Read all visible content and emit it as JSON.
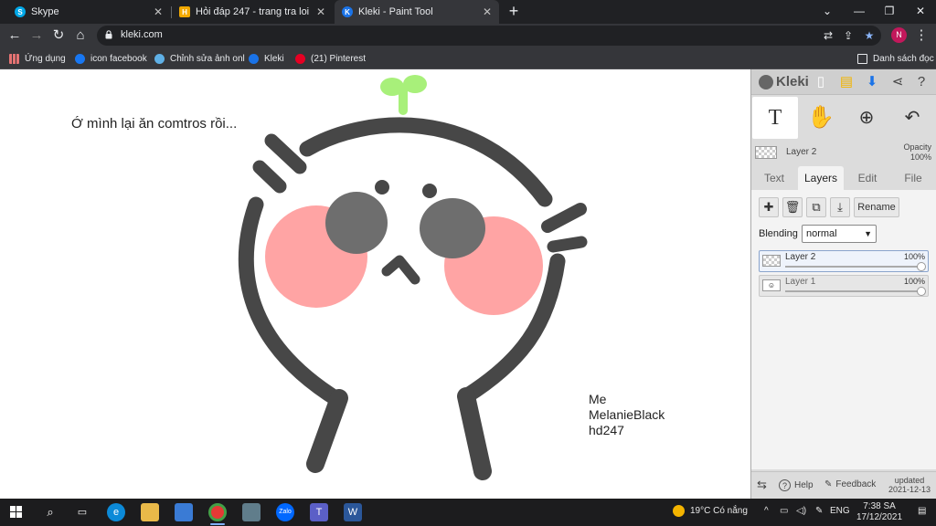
{
  "browser": {
    "tabs": [
      {
        "title": "Skype",
        "icon": "skype-icon",
        "color": "#00a8e8",
        "active": false
      },
      {
        "title": "Hỏi đáp 247 - trang tra loi",
        "icon": "hoidap-icon",
        "color": "#f2a900",
        "active": false
      },
      {
        "title": "Kleki - Paint Tool",
        "icon": "kleki-icon",
        "color": "#1a73e8",
        "active": true
      }
    ],
    "url": "kleki.com",
    "profile_initial": "N",
    "bookmarks": [
      {
        "label": "Ứng dụng",
        "icon": "apps-grid-icon",
        "color": "#e57373"
      },
      {
        "label": "icon facebook",
        "icon": "facebook-bookmark-icon",
        "color": "#1877f2"
      },
      {
        "label": "Chỉnh sửa ảnh onl",
        "icon": "photo-edit-bookmark-icon",
        "color": "#5fb0e6"
      },
      {
        "label": "Kleki",
        "icon": "kleki-bookmark-icon",
        "color": "#1a73e8"
      },
      {
        "label": "(21) Pinterest",
        "icon": "pinterest-icon",
        "color": "#e60023"
      }
    ],
    "reading_list": "Danh sách đọc"
  },
  "drawing": {
    "caption": "Ớ mình lại ăn comtros rồi...",
    "signature_line1": "Me",
    "signature_line2": "MelanieBlack",
    "signature_line3": "hd247",
    "colors": {
      "outline": "#474747",
      "cheek": "#ffa4a4",
      "eye": "#6e6e6e",
      "sprout": "#a8f07a"
    }
  },
  "kleki": {
    "logo": "Kleki",
    "tools": [
      {
        "name": "text-tool",
        "glyph": "T"
      },
      {
        "name": "hand-tool",
        "glyph": "✋"
      },
      {
        "name": "zoom-tool",
        "glyph": "⊕"
      },
      {
        "name": "undo-redo-tool",
        "glyph": "↶"
      }
    ],
    "current_layer": "Layer 2",
    "opacity_label": "Opacity",
    "opacity_value": "100%",
    "tabs": [
      "Text",
      "Layers",
      "Edit",
      "File"
    ],
    "active_tab": "Layers",
    "rename_label": "Rename",
    "blending_label": "Blending",
    "blending_value": "normal",
    "layers": [
      {
        "name": "Layer 2",
        "opacity": "100%",
        "active": true
      },
      {
        "name": "Layer 1",
        "opacity": "100%",
        "active": false
      }
    ],
    "help_label": "Help",
    "feedback_label": "Feedback",
    "updated_label": "updated",
    "updated_date": "2021-12-13"
  },
  "taskbar": {
    "weather": "19°C  Có nắng",
    "lang": "ENG",
    "time": "7:38 SA",
    "date": "17/12/2021"
  }
}
